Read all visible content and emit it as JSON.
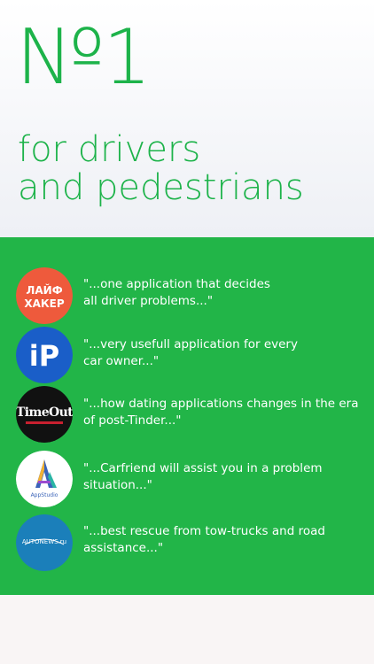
{
  "hero": {
    "headline": "№1",
    "tagline_line1": "for drivers",
    "tagline_line2": "and pedestrians"
  },
  "colors": {
    "brand_green": "#1db34a",
    "band_green": "#22b548",
    "lifehacker_red": "#ee5a3c",
    "ip_blue": "#1a5ec8",
    "timeout_black": "#111111",
    "autonews_blue": "#1b7fba"
  },
  "reviews": [
    {
      "source_icon": "lifehacker-logo",
      "logo_lines": [
        "ЛАЙФ",
        "ХАКЕР"
      ],
      "quote_line1": "\"...one application that decides",
      "quote_line2": "all driver problems...\""
    },
    {
      "source_icon": "ip-logo",
      "logo_text": "iP",
      "quote_line1": "\"...very usefull application for every",
      "quote_line2": "car owner...\""
    },
    {
      "source_icon": "timeout-logo",
      "logo_text": "TimeOut",
      "quote_line1": "\"...how dating applications changes in the era",
      "quote_line2": "of post-Tinder...\""
    },
    {
      "source_icon": "appstudio-logo",
      "logo_text": "AppStudio",
      "quote_line1": "\"...Carfriend will assist you in a problem",
      "quote_line2": "situation...\""
    },
    {
      "source_icon": "autonews-logo",
      "logo_text": "AUTONEWS.ru",
      "quote_line1": "\"...best rescue from tow-trucks and road",
      "quote_line2": "assistance...\""
    }
  ]
}
